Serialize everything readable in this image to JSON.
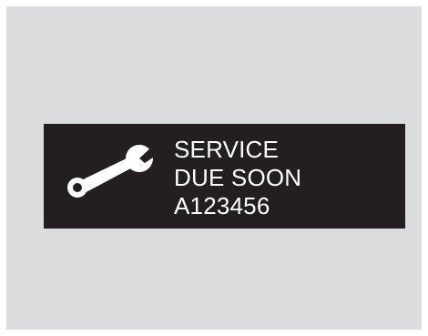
{
  "display": {
    "line1": "SERVICE",
    "line2": "DUE SOON",
    "code": "A123456",
    "icon": "wrench-icon",
    "colors": {
      "screen": "#231f20",
      "text": "#ffffff",
      "panel": "#dcdddf"
    }
  }
}
